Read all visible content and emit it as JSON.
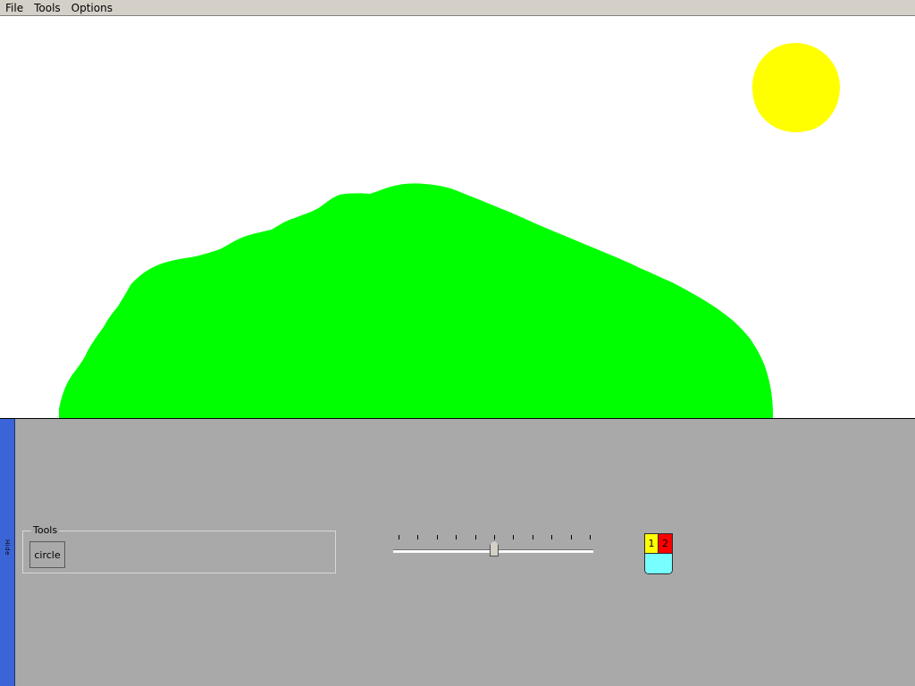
{
  "menubar": {
    "items": [
      {
        "label": "File"
      },
      {
        "label": "Tools"
      },
      {
        "label": "Options"
      }
    ]
  },
  "canvas": {
    "background": "#ffffff",
    "shapes": [
      {
        "name": "sun",
        "color": "#ffff00"
      },
      {
        "name": "hill",
        "color": "#00ff00"
      }
    ]
  },
  "panel": {
    "background": "#a9a9a9",
    "hide_strip": {
      "label": "Hide",
      "color": "#3b64d6"
    },
    "tools_group": {
      "legend": "Tools",
      "tools": [
        {
          "label": "circle"
        }
      ]
    },
    "slider": {
      "ticks": 11,
      "level_fraction": 0.5
    },
    "palette": {
      "primary": {
        "label": "1",
        "color": "#ffff00"
      },
      "secondary": {
        "label": "2",
        "color": "#ff0000"
      },
      "bottom_color": "#77ffff"
    }
  }
}
